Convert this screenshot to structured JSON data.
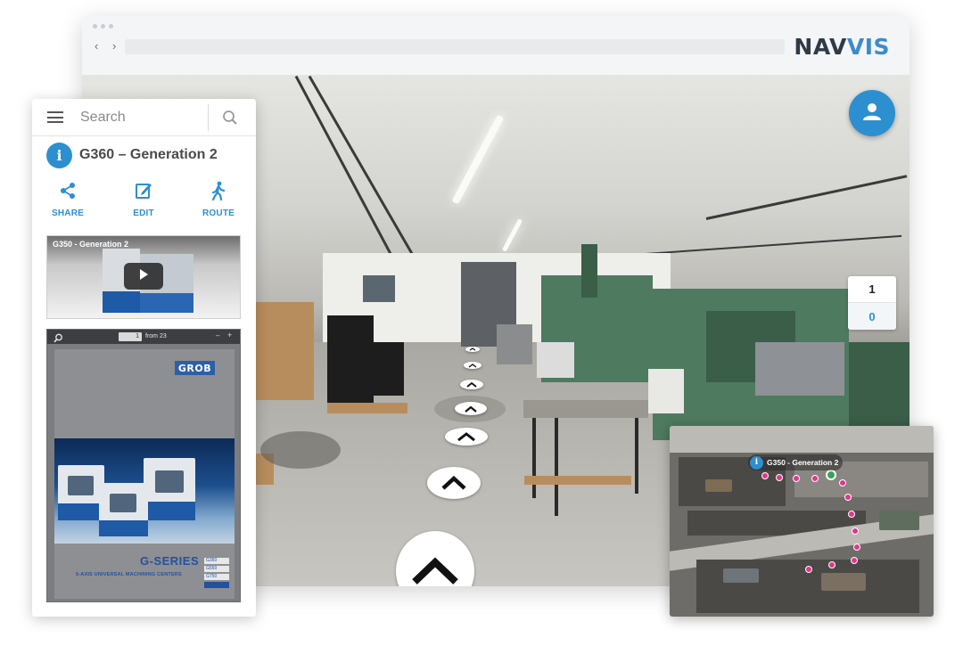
{
  "brand": {
    "logo_part1": "NAV",
    "logo_part2": "VIS",
    "accent": "#2c8fd0",
    "logo_dark": "#2f3a47"
  },
  "browser": {
    "nav_buttons": "‹ ›",
    "url": ""
  },
  "viewer": {
    "user_button_icon": "user-icon",
    "floors": [
      "1",
      "0"
    ],
    "active_floor": "0"
  },
  "panel": {
    "search_placeholder": "Search",
    "menu_icon": "hamburger-icon",
    "search_icon": "search-icon",
    "poi": {
      "info_icon_glyph": "i",
      "title": "G360 – Generation 2"
    },
    "actions": [
      {
        "icon": "share-icon",
        "label": "SHARE"
      },
      {
        "icon": "edit-icon",
        "label": "EDIT"
      },
      {
        "icon": "walking-person-icon",
        "label": "ROUTE"
      }
    ],
    "video": {
      "title": "G350 - Generation 2",
      "play_icon": "play-icon"
    },
    "pdf": {
      "page": "1",
      "page_of": "from 23",
      "minus": "–",
      "plus": "+",
      "brand": "GROB",
      "series": "G-SERIES",
      "subtitle": "5-AXIS UNIVERSAL MACHINING CENTERS",
      "models": [
        "G350",
        "G550",
        "G750"
      ]
    }
  },
  "minimap": {
    "info_icon_glyph": "i",
    "label": "G350 - Generation 2",
    "route_color": "#e0368e",
    "current_color": "#3aa35a"
  }
}
